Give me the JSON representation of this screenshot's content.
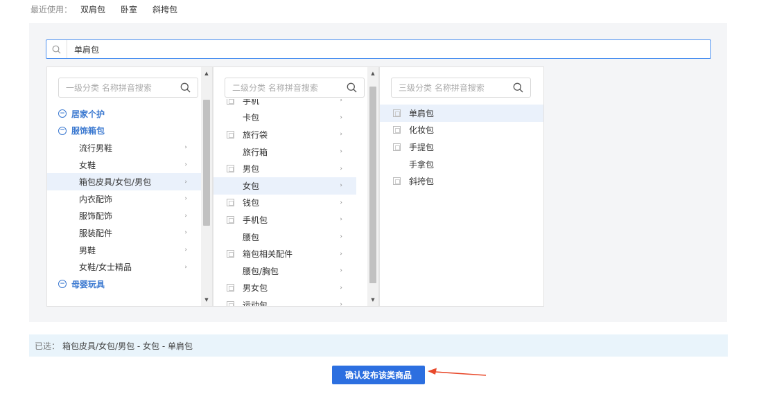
{
  "recent": {
    "label": "最近使用：",
    "items": [
      "双肩包",
      "卧室",
      "斜挎包"
    ]
  },
  "search": {
    "value": "单肩包"
  },
  "columns": {
    "level1": {
      "placeholder": "一级分类 名称拼音搜索",
      "rows": [
        {
          "type": "group",
          "label": "居家个护"
        },
        {
          "type": "group",
          "label": "服饰箱包"
        },
        {
          "type": "item",
          "label": "流行男鞋"
        },
        {
          "type": "item",
          "label": "女鞋"
        },
        {
          "type": "item",
          "label": "箱包皮具/女包/男包",
          "selected": true
        },
        {
          "type": "item",
          "label": "内衣配饰"
        },
        {
          "type": "item",
          "label": "服饰配饰"
        },
        {
          "type": "item",
          "label": "服装配件"
        },
        {
          "type": "item",
          "label": "男鞋"
        },
        {
          "type": "item",
          "label": "女鞋/女士精品"
        },
        {
          "type": "group",
          "label": "母婴玩具"
        }
      ]
    },
    "level2": {
      "placeholder": "二级分类 名称拼音搜索",
      "rows": [
        {
          "label": "手机",
          "icon": true
        },
        {
          "label": "卡包",
          "icon": false
        },
        {
          "label": "旅行袋",
          "icon": true
        },
        {
          "label": "旅行箱",
          "icon": false
        },
        {
          "label": "男包",
          "icon": true
        },
        {
          "label": "女包",
          "icon": false,
          "selected": true
        },
        {
          "label": "钱包",
          "icon": true
        },
        {
          "label": "手机包",
          "icon": true
        },
        {
          "label": "腰包",
          "icon": false
        },
        {
          "label": "箱包相关配件",
          "icon": true
        },
        {
          "label": "腰包/胸包",
          "icon": false
        },
        {
          "label": "男女包",
          "icon": true
        },
        {
          "label": "运动包",
          "icon": true
        }
      ]
    },
    "level3": {
      "placeholder": "三级分类 名称拼音搜索",
      "rows": [
        {
          "label": "单肩包",
          "icon": true,
          "selected": true
        },
        {
          "label": "化妆包",
          "icon": true
        },
        {
          "label": "手提包",
          "icon": true
        },
        {
          "label": "手拿包",
          "icon": false
        },
        {
          "label": "斜挎包",
          "icon": true
        }
      ]
    }
  },
  "chosen": {
    "label": "已选：",
    "path": "箱包皮具/女包/男包 - 女包 - 单肩包"
  },
  "confirm_label": "确认发布该类商品",
  "colors": {
    "accent": "#2c6fe0",
    "arrow": "#e8492b",
    "selected_bg": "#eaf1fb"
  }
}
